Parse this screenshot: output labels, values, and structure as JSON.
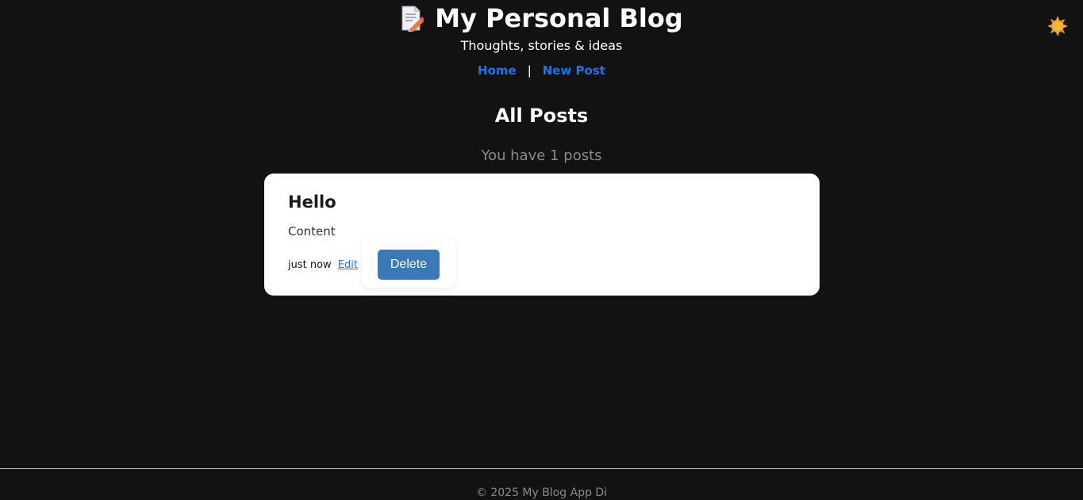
{
  "header": {
    "logo_icon": "memo-pencil-icon",
    "title": "My Personal Blog",
    "tagline": "Thoughts, stories & ideas",
    "theme_toggle_icon": "sun-icon"
  },
  "nav": {
    "home_label": "Home",
    "separator": "|",
    "new_post_label": "New Post"
  },
  "main": {
    "heading": "All Posts",
    "post_count_text": "You have 1 posts",
    "posts": [
      {
        "title": "Hello",
        "content": "Content",
        "timestamp": "just now",
        "edit_label": "Edit",
        "delete_label": "Delete"
      }
    ]
  },
  "footer": {
    "text": "© 2025 My Blog App Di"
  },
  "colors": {
    "background": "#121212",
    "link": "#1a73f0",
    "delete_button": "#3a79b8",
    "card": "#ffffff"
  }
}
